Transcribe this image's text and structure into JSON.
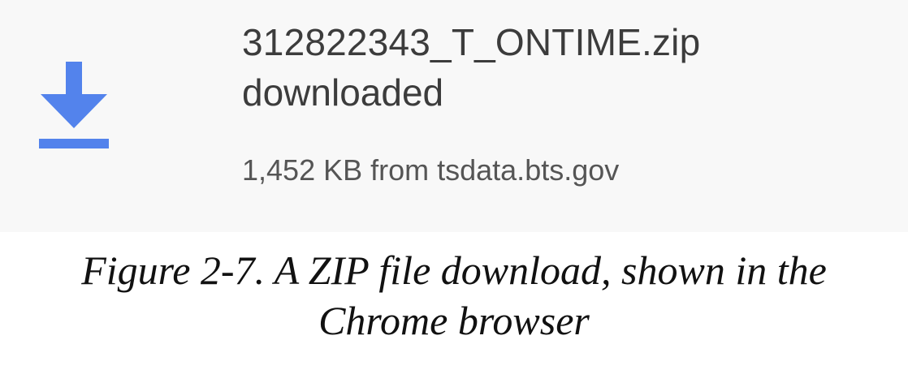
{
  "download": {
    "icon": "download-icon",
    "accent_color": "#5383ec",
    "file_name": "312822343_T_ONTIME.zip",
    "status": "downloaded",
    "meta": "1,452 KB from tsdata.bts.gov"
  },
  "caption": {
    "line1": "Figure 2-7. A ZIP file download, shown in the",
    "line2": "Chrome browser"
  }
}
